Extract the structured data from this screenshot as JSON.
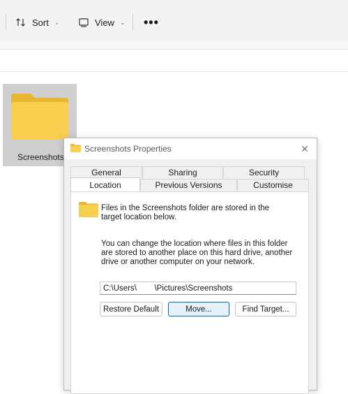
{
  "toolbar": {
    "sort_label": "Sort",
    "view_label": "View",
    "more_label": "•••"
  },
  "folder": {
    "label": "Screenshots"
  },
  "dialog": {
    "title": "Screenshots Properties",
    "close_label": "✕",
    "tabs_row1": [
      "General",
      "Sharing",
      "Security"
    ],
    "tabs_row2": [
      "Location",
      "Previous Versions",
      "Customise"
    ],
    "active_tab": "Location",
    "description": "Files in the Screenshots folder are stored in the target location below.",
    "info": "You can change the location where files in this folder are stored to another place on this hard drive, another drive or another computer on your network.",
    "path_value": "C:\\Users\\        \\Pictures\\Screenshots",
    "buttons": {
      "restore": "Restore Default",
      "move": "Move...",
      "find": "Find Target..."
    }
  },
  "colors": {
    "folder_yellow": "#f8cf4f",
    "selection_gray": "#cfcfcf",
    "accent_blue": "#0067c0"
  }
}
